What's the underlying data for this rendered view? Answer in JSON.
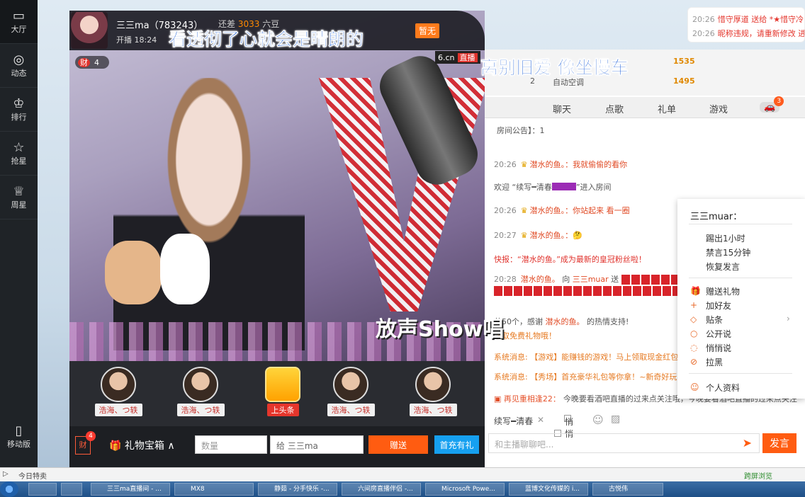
{
  "leftnav": {
    "items": [
      {
        "label": "大厅",
        "icon": "tv-icon"
      },
      {
        "label": "动态",
        "icon": "compass-icon"
      },
      {
        "label": "排行",
        "icon": "crown-icon"
      },
      {
        "label": "抢星",
        "icon": "star-icon"
      },
      {
        "label": "周星",
        "icon": "trophy-icon"
      }
    ],
    "mobile_label": "移动版"
  },
  "anchor": {
    "name": "三三ma（783243）",
    "rank_text": "还差",
    "rank_value": "3033",
    "rank_suffix": "六豆",
    "start_time": "开播 18:24",
    "status_tag": "暂无",
    "wealth_badge": "4"
  },
  "overlay": {
    "line1": "看透彻了心就会是晴朗的",
    "line2": "离别旧爱 像坐慢车"
  },
  "video": {
    "logo": "6.cn",
    "live_tag": "直播",
    "show_logo": "放声Show唱"
  },
  "fans": [
    {
      "name": "浩海、つ轶"
    },
    {
      "name": "浩海、つ轶"
    },
    {
      "name": "上头条"
    },
    {
      "name": "浩海、つ轶"
    },
    {
      "name": "浩海、つ轶"
    }
  ],
  "giftbar": {
    "wealth_badge": "4",
    "box_label": "礼物宝箱",
    "qty_placeholder": "数量",
    "to_label": "给 三三ma",
    "send_label": "赠送",
    "recharge_label": "首充有礼"
  },
  "rank_list": [
    {
      "idx": "",
      "name": "",
      "coins": "1535"
    },
    {
      "idx": "2",
      "name": "自动空调",
      "coins": "1495"
    }
  ],
  "tabs": [
    "聊天",
    "点歌",
    "礼单",
    "游戏"
  ],
  "car_badge": "3",
  "chat": {
    "announcement": "房间公告】：1",
    "lines": [
      {
        "time": "20:26",
        "user": "潜水的鱼。",
        "text": "：我就偷偷的看你"
      },
      {
        "welcome": "欢迎 “续写━清春",
        "tail": "”进入房间"
      },
      {
        "time": "20:26",
        "user": "潜水的鱼。",
        "text": "：你站起来 看一圈"
      },
      {
        "time": "20:27",
        "user": "潜水的鱼。",
        "text": "："
      },
      {
        "hot": "快报：“潜水的鱼。”成为最新的皇冠粉丝啦！"
      },
      {
        "time": "20:28",
        "user": "潜水的鱼。",
        "text": "向",
        "to": "三三muar",
        "verb": "送"
      },
      {
        "thanks": "共50个，感谢",
        "user": "潜水的鱼。",
        "tail": "的热情支持!"
      },
      {
        "sys": "领取免费礼物哦！"
      },
      {
        "sys": "系统消息: 【游戏】能赚钱的游戏！马上领取现金红包"
      },
      {
        "sys": "系统消息: 【秀场】首充豪华礼包等你拿！~新奇好玩"
      },
      {
        "ad_name": "再见重相逢22：",
        "ad_text": "今晚要看酒吧直播的过来点关注哦，今晚要看酒吧直播的过来点关注"
      }
    ]
  },
  "input": {
    "target": "续写━清春",
    "private_label": "悄悄",
    "placeholder": "和主播聊聊吧...",
    "send_label": "发言"
  },
  "context_menu": {
    "title": "三三muar：",
    "items_admin": [
      "踢出1小时",
      "禁言15分钟",
      "恢复发言"
    ],
    "items_main": [
      {
        "label": "赠送礼物",
        "icon": "gift-icon"
      },
      {
        "label": "加好友",
        "icon": "plus-icon"
      },
      {
        "label": "贴条",
        "icon": "tag-icon"
      },
      {
        "label": "公开说",
        "icon": "chat-bubble-icon"
      },
      {
        "label": "悄悄说",
        "icon": "whisper-icon"
      },
      {
        "label": "拉黑",
        "icon": "block-icon"
      }
    ],
    "profile_label": "个人资料"
  },
  "notice": [
    {
      "time": "20:26",
      "text": "惜守厚道 送给 *★惜守冷"
    },
    {
      "time": "20:26",
      "text": "昵称违规，请重新修改 进"
    }
  ],
  "statusbar": {
    "left": "今日特卖",
    "right": "跨屏浏览"
  },
  "taskbar": [
    "三三ma直播间 - ...",
    "MX8",
    "静茹 - 分手快乐 -...",
    "六间房直播伴侣 -...",
    "Microsoft Powe...",
    "蓝博文化传媒的 i...",
    "古悦伟"
  ]
}
